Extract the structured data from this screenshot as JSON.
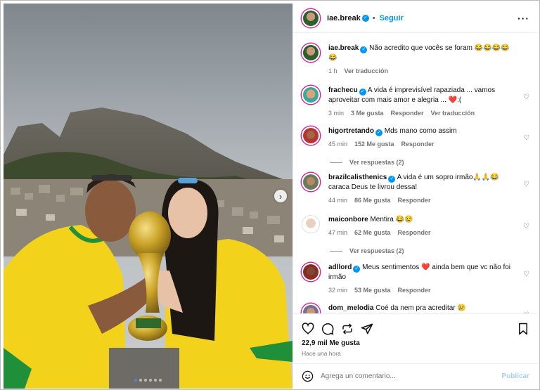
{
  "post": {
    "author": "iae.break",
    "follow_label": "Seguir",
    "dot": "•",
    "more_icon": "more-horizontal-icon",
    "more_label": "···"
  },
  "comments": [
    {
      "user": "iae.break",
      "verified": true,
      "text": "Não acredito que vocês se foram 😂😂😂😂😂",
      "time": "1 h",
      "likes": "",
      "reply": "",
      "translate": "Ver traducción",
      "replies": ""
    },
    {
      "user": "frachecu",
      "verified": true,
      "text": "A vida é imprevisível rapaziada ... vamos aproveitar com mais amor e alegria ... ❤️:(",
      "time": "3 min",
      "likes": "3 Me gusta",
      "reply": "Responder",
      "translate": "Ver traducción",
      "replies": ""
    },
    {
      "user": "higortretando",
      "verified": true,
      "text": "Mds mano como assim",
      "time": "45 min",
      "likes": "152 Me gusta",
      "reply": "Responder",
      "translate": "",
      "replies": "Ver respuestas (2)"
    },
    {
      "user": "brazilcalisthenics",
      "verified": true,
      "text": "A vida é um sopro irmão🙏🙏😂 caraca Deus te livrou dessa!",
      "time": "44 min",
      "likes": "86 Me gusta",
      "reply": "Responder",
      "translate": "",
      "replies": ""
    },
    {
      "user": "maiconbore",
      "verified": false,
      "text": "Mentira 😂😢",
      "time": "47 min",
      "likes": "62 Me gusta",
      "reply": "Responder",
      "translate": "",
      "replies": "Ver respuestas (2)"
    },
    {
      "user": "adllord",
      "verified": true,
      "text": "Meus sentimentos ❤️ ainda bem que vc não foi irmão",
      "time": "32 min",
      "likes": "53 Me gusta",
      "reply": "Responder",
      "translate": "",
      "replies": ""
    },
    {
      "user": "dom_melodia",
      "verified": false,
      "text": "Coé da nem pra acreditar 😢",
      "time": "",
      "likes": "",
      "reply": "",
      "translate": "",
      "replies": ""
    }
  ],
  "actions": {
    "likes_count": "22,9 mil Me gusta",
    "posted_time": "Hace una hora"
  },
  "composer": {
    "placeholder": "Agrega un comentario...",
    "publish_label": "Publicar"
  },
  "carousel": {
    "next_icon": "chevron-right-icon",
    "next_glyph": "›",
    "slides_count": 6,
    "active_index": 0
  },
  "colors": {
    "accent": "#0095f6",
    "jersey_yellow": "#f2d21b",
    "jersey_green": "#1f8f3a",
    "trophy_gold": "#c9a227"
  }
}
